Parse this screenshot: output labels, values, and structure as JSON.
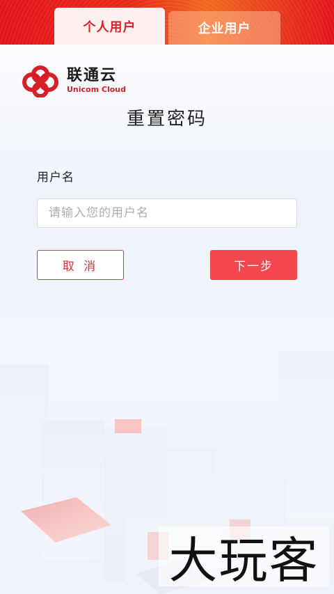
{
  "tabs": {
    "personal": "个人用户",
    "enterprise": "企业用户"
  },
  "logo": {
    "name_cn": "联通云",
    "name_en": "Unicom Cloud",
    "icon": "unicom-knot-icon",
    "brand_color": "#d81e26"
  },
  "page": {
    "title": "重置密码"
  },
  "form": {
    "username_label": "用户名",
    "username_placeholder": "请输入您的用户名",
    "username_value": ""
  },
  "buttons": {
    "cancel": "取 消",
    "next": "下一步"
  },
  "colors": {
    "accent": "#f2474f",
    "header": "#e2141c"
  },
  "watermark": "大玩客"
}
